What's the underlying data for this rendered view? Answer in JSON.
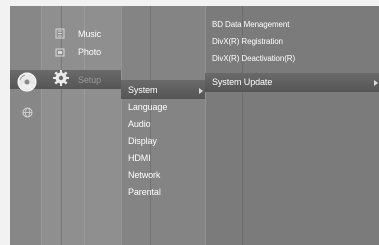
{
  "menu": {
    "disc_label": "DVD",
    "main_items": [
      {
        "label": "Music",
        "icon": "music-icon"
      },
      {
        "label": "Photo",
        "icon": "photo-icon"
      },
      {
        "label": "Setup",
        "icon": "gear-icon"
      }
    ],
    "setup_items": [
      "System",
      "Language",
      "Audio",
      "Display",
      "HDMI",
      "Network",
      "Parental"
    ],
    "system_items": [
      "BD Data Menagement",
      "DivX(R) Registration",
      "DivX(R) Deactivation(R)",
      "System Update"
    ],
    "icons": {
      "disc": "disc-icon",
      "network": "globe-icon"
    },
    "colors": {
      "background": "#7a7a7a",
      "highlight": "#5a5a5a",
      "text": "#ffffff"
    }
  }
}
